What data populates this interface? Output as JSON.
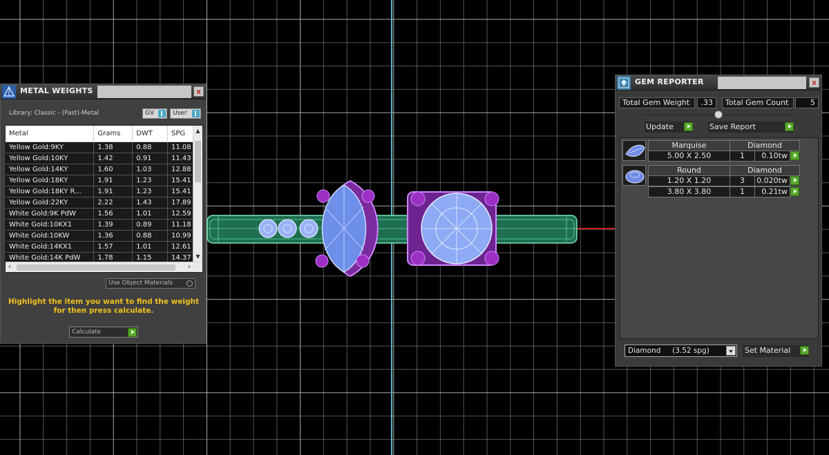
{
  "metal_panel": {
    "title": "METAL WEIGHTS",
    "close": "x",
    "library": "Library: Classic - (Fast)-Metal",
    "toggle_gv": "GV",
    "toggle_user": "User",
    "columns": [
      "Metal",
      "Grams",
      "DWT",
      "SPG"
    ],
    "rows": [
      [
        "Yellow Gold:9KY",
        "1.38",
        "0.88",
        "11.08"
      ],
      [
        "Yellow Gold:10KY",
        "1.42",
        "0.91",
        "11.43"
      ],
      [
        "Yellow Gold:14KY",
        "1.60",
        "1.03",
        "12.88"
      ],
      [
        "Yellow Gold:18KY",
        "1.91",
        "1.23",
        "15.41"
      ],
      [
        "Yellow Gold:18KY R...",
        "1.91",
        "1.23",
        "15.41"
      ],
      [
        "Yellow Gold:22KY",
        "2.22",
        "1.43",
        "17.89"
      ],
      [
        "White Gold:9K PdW",
        "1.56",
        "1.01",
        "12.59"
      ],
      [
        "White Gold:10KX1",
        "1.39",
        "0.89",
        "11.18"
      ],
      [
        "White Gold:10KW",
        "1.36",
        "0.88",
        "10.99"
      ],
      [
        "White Gold:14KX1",
        "1.57",
        "1.01",
        "12.61"
      ],
      [
        "White Gold:14K PdW",
        "1.78",
        "1.15",
        "14.37"
      ]
    ],
    "use_object_materials": "Use Object Materials",
    "hint": "Highlight the item you want to find the weight for then press calculate.",
    "calculate": "Calculate"
  },
  "gem_panel": {
    "title": "GEM REPORTER",
    "close": "x",
    "total_weight_label": "Total Gem Weight",
    "total_weight_value": ".33",
    "total_count_label": "Total Gem Count",
    "total_count_value": "5",
    "update": "Update",
    "save_report": "Save Report",
    "groups": [
      {
        "shape": "Marquise",
        "material": "Diamond",
        "items": [
          {
            "size": "5.00 X 2.50",
            "count": "1",
            "weight": "0.10tw"
          }
        ]
      },
      {
        "shape": "Round",
        "material": "Diamond",
        "items": [
          {
            "size": "1.20 X 1.20",
            "count": "3",
            "weight": "0.020tw"
          },
          {
            "size": "3.80 X 3.80",
            "count": "1",
            "weight": "0.21tw"
          }
        ]
      }
    ],
    "material_select": "Diamond     (3.52 spg)",
    "set_material": "Set Material"
  },
  "colors": {
    "background": "#000000",
    "grid": "#9a9a9a",
    "axis_y": "#5fb7d2",
    "axis_x": "#c82020",
    "band": "#3aa37a",
    "prongs": "#9c2fc4",
    "gem_fill": "#6e8fe8",
    "hint_text": "#f0c020",
    "green_button": "#58a82a"
  },
  "icons": {
    "metal_panel": "pyramid-icon",
    "gem_panel": "gem-report-icon"
  }
}
